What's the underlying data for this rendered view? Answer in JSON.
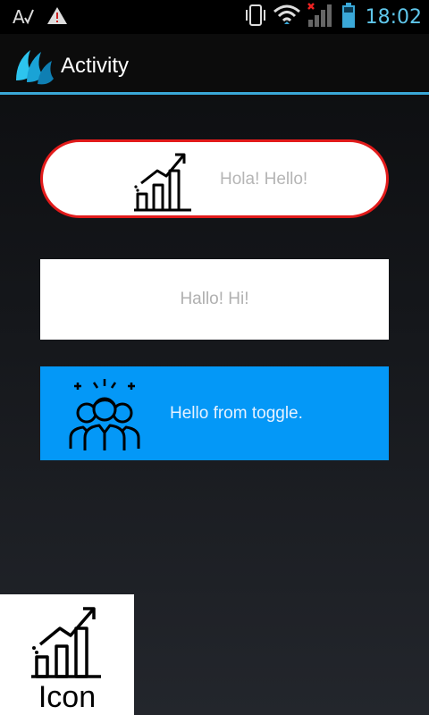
{
  "status_bar": {
    "left_icons": [
      "text-check-icon",
      "warning-icon"
    ],
    "right_icons": [
      "vibrate-icon",
      "wifi-icon",
      "signal-icon",
      "battery-icon"
    ],
    "time": "18:02"
  },
  "action_bar": {
    "title": "Activity",
    "accent_color": "#3aa8d8"
  },
  "buttons": [
    {
      "label": "Hola! Hello!",
      "icon": "chart-growth-icon",
      "style": "pill",
      "border_color": "#e21b1b"
    },
    {
      "label": "Hallo! Hi!",
      "style": "plain"
    },
    {
      "label": "Hello from toggle.",
      "icon": "team-icon",
      "style": "toggle",
      "background": "#0498f7"
    }
  ],
  "bottom_widget": {
    "label": "Icon",
    "icon": "chart-growth-icon"
  }
}
